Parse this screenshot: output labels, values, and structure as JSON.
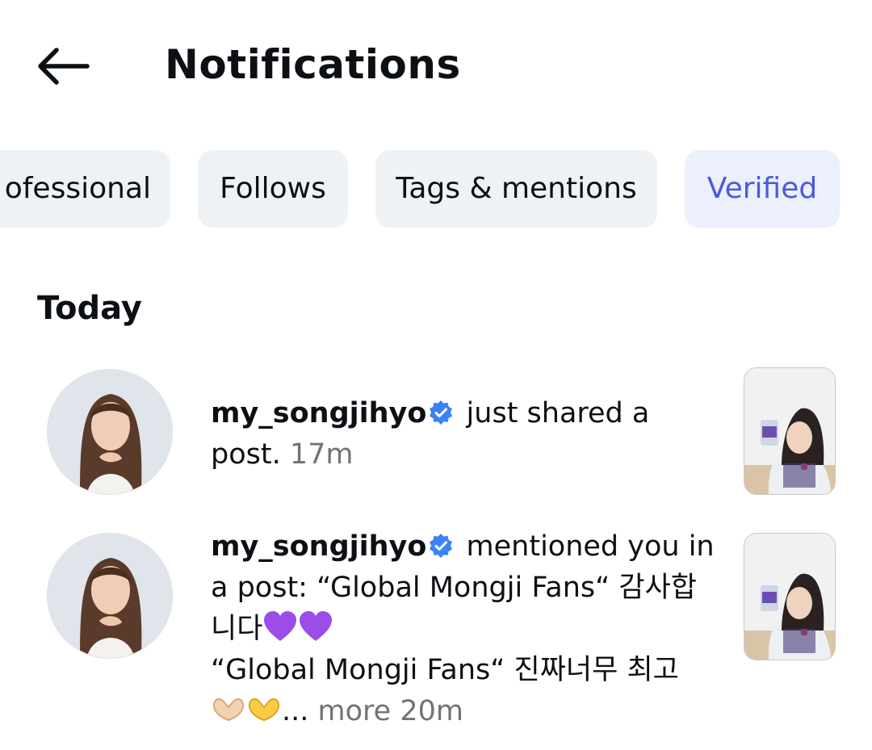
{
  "header": {
    "title": "Notifications",
    "back_icon": "arrow-left-icon"
  },
  "tabs": [
    {
      "label": "Professional",
      "visible_label": "ofessional",
      "active": false
    },
    {
      "label": "Follows",
      "active": false
    },
    {
      "label": "Tags & mentions",
      "active": false
    },
    {
      "label": "Verified",
      "active": true
    }
  ],
  "section": {
    "title": "Today"
  },
  "notifications": [
    {
      "username": "my_songjihyo",
      "verified": true,
      "action": "just shared a post.",
      "time": "17m"
    },
    {
      "username": "my_songjihyo",
      "verified": true,
      "action_line1": "mentioned you in a post: “Global Mongji Fans“ 감사합니다",
      "action_line2": "“Global Mongji Fans“ 진짜너무 최고",
      "ellipsis": "...",
      "more": "more",
      "time": "20m"
    }
  ],
  "colors": {
    "active_tab_text": "#4a5bd9",
    "active_tab_bg": "#eceffc",
    "tab_bg": "#eff2f5",
    "verified_badge": "#3b82f6",
    "muted_text": "#737373"
  }
}
